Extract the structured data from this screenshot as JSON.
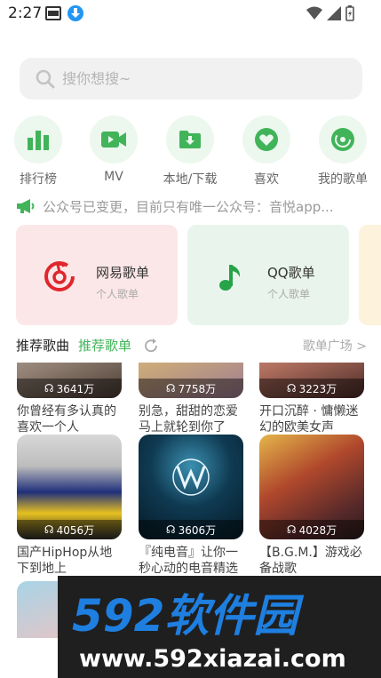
{
  "status": {
    "time": "2:27"
  },
  "search": {
    "placeholder": "搜你想搜~"
  },
  "quick": [
    {
      "label": "排行榜",
      "icon": "bar-chart-icon"
    },
    {
      "label": "MV",
      "icon": "video-icon"
    },
    {
      "label": "本地/下载",
      "icon": "folder-download-icon"
    },
    {
      "label": "喜欢",
      "icon": "heart-icon"
    },
    {
      "label": "我的歌单",
      "icon": "disc-icon"
    }
  ],
  "notice": {
    "text": "公众号已变更，目前只有唯一公众号：音悦app..."
  },
  "cards": [
    {
      "title": "网易歌单",
      "sub": "个人歌单"
    },
    {
      "title": "QQ歌单",
      "sub": "个人歌单"
    }
  ],
  "section": {
    "title": "推荐歌曲",
    "tab": "推荐歌单",
    "more": "歌单广场 >"
  },
  "songs": [
    {
      "count": "3641万",
      "caption": "你曾经有多认真的喜欢一个人"
    },
    {
      "count": "7758万",
      "caption": "别急，甜甜的恋爱马上就轮到你了"
    },
    {
      "count": "3223万",
      "caption": "开口沉醉 · 慵懒迷幻的欧美女声"
    },
    {
      "count": "4056万",
      "caption": "国产HipHop从地下到地上"
    },
    {
      "count": "3606万",
      "caption": "『纯电音』让你一秒心动的电音精选"
    },
    {
      "count": "4028万",
      "caption": "【B.G.M.】游戏必备战歌"
    }
  ],
  "watermark": {
    "big": "592软件园",
    "url": "www.592xiazai.com"
  },
  "colors": {
    "green": "#41b45a",
    "netease": "#e0262d",
    "qq": "#27a34a"
  }
}
